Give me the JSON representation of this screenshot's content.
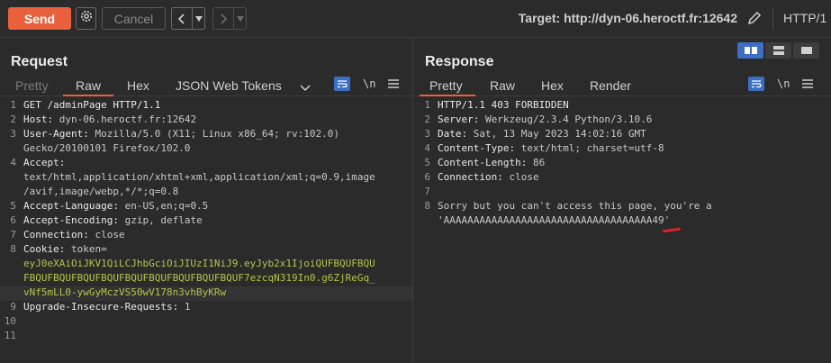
{
  "toolbar": {
    "send_label": "Send",
    "cancel_label": "Cancel",
    "back_glyph": "<",
    "forward_glyph": ">",
    "dropdown_glyph": "▾",
    "target_label": "Target: http://dyn-06.heroctf.fr:12642",
    "http_version": "HTTP/1"
  },
  "request": {
    "title": "Request",
    "tabs": [
      "Pretty",
      "Raw",
      "Hex",
      "JSON Web Tokens"
    ],
    "active_tab": "Raw",
    "newline_label": "\\n",
    "lines": [
      {
        "n": "1",
        "key": "GET /adminPage HTTP/1.1",
        "val": ""
      },
      {
        "n": "2",
        "key": "Host: ",
        "val": "dyn-06.heroctf.fr:12642"
      },
      {
        "n": "3",
        "key": "User-Agent: ",
        "val": "Mozilla/5.0 (X11; Linux x86_64; rv:102.0)"
      },
      {
        "n": "",
        "key": "",
        "val": "Gecko/20100101 Firefox/102.0"
      },
      {
        "n": "4",
        "key": "Accept: ",
        "val": ""
      },
      {
        "n": "",
        "key": "",
        "val": "text/html,application/xhtml+xml,application/xml;q=0.9,image"
      },
      {
        "n": "",
        "key": "",
        "val": "/avif,image/webp,*/*;q=0.8"
      },
      {
        "n": "5",
        "key": "Accept-Language: ",
        "val": "en-US,en;q=0.5"
      },
      {
        "n": "6",
        "key": "Accept-Encoding: ",
        "val": "gzip, deflate"
      },
      {
        "n": "7",
        "key": "Connection: ",
        "val": "close"
      },
      {
        "n": "8",
        "key": "Cookie: ",
        "val": "token="
      },
      {
        "n": "",
        "key": "",
        "val": "",
        "token": "eyJ0eXAiOiJKV1QiLCJhbGciOiJIUzI1NiJ9.eyJyb2x1IjoiQUFBQUFBQU"
      },
      {
        "n": "",
        "key": "",
        "val": "",
        "token": "FBQUFBQUFBQUFBQUFBQUFBQUFBQUFBQUFBQUF7ezcqN319In0.g6ZjReGq_"
      },
      {
        "n": "",
        "key": "",
        "val": "",
        "token": "vNf5mLL0-ywGyMczVS50wV178n3vhByKRw"
      },
      {
        "n": "9",
        "key": "Upgrade-Insecure-Requests: ",
        "val": "1"
      },
      {
        "n": "10",
        "key": "",
        "val": ""
      },
      {
        "n": "11",
        "key": "",
        "val": ""
      }
    ]
  },
  "response": {
    "title": "Response",
    "tabs": [
      "Pretty",
      "Raw",
      "Hex",
      "Render"
    ],
    "active_tab": "Pretty",
    "newline_label": "\\n",
    "lines": [
      {
        "n": "1",
        "key": "HTTP/1.1 403 FORBIDDEN",
        "val": ""
      },
      {
        "n": "2",
        "key": "Server: ",
        "val": "Werkzeug/2.3.4 Python/3.10.6"
      },
      {
        "n": "3",
        "key": "Date: ",
        "val": "Sat, 13 May 2023 14:02:16 GMT"
      },
      {
        "n": "4",
        "key": "Content-Type: ",
        "val": "text/html; charset=utf-8"
      },
      {
        "n": "5",
        "key": "Content-Length: ",
        "val": "86"
      },
      {
        "n": "6",
        "key": "Connection: ",
        "val": "close"
      },
      {
        "n": "7",
        "key": "",
        "val": ""
      },
      {
        "n": "8",
        "key": "",
        "val": "Sorry but you can't access this page, you're a"
      },
      {
        "n": "",
        "key": "",
        "val": "'AAAAAAAAAAAAAAAAAAAAAAAAAAAAAAAAAAA49'"
      }
    ]
  },
  "icons": {
    "settings": "gear-icon",
    "edit": "pencil-icon",
    "wrap": "word-wrap-icon",
    "menu": "hamburger-menu-icon",
    "expand": "chevron-down-icon",
    "layout_split": "layout-side-by-side-icon",
    "layout_stacked": "layout-top-bottom-icon",
    "layout_single": "layout-single-icon"
  },
  "colors": {
    "send": "#e8613c",
    "accent_blue": "#3a6fc4",
    "token": "#b5c449",
    "annotation": "#e0202a"
  }
}
